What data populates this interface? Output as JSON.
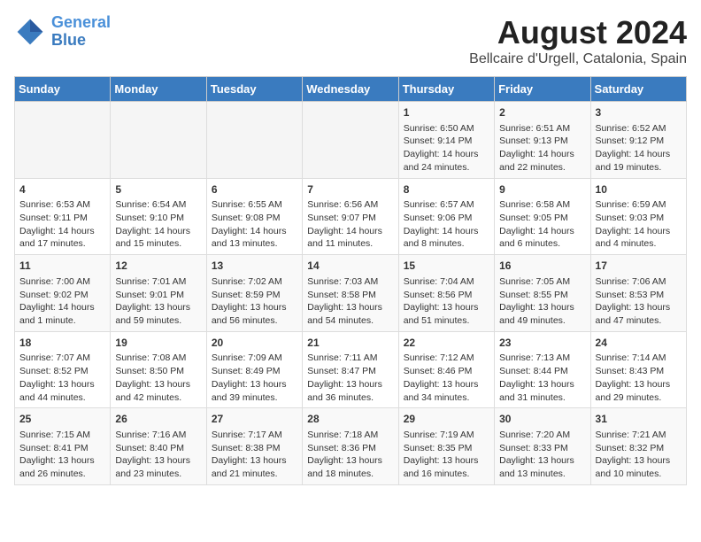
{
  "header": {
    "logo_line1": "General",
    "logo_line2": "Blue",
    "title": "August 2024",
    "subtitle": "Bellcaire d'Urgell, Catalonia, Spain"
  },
  "days_of_week": [
    "Sunday",
    "Monday",
    "Tuesday",
    "Wednesday",
    "Thursday",
    "Friday",
    "Saturday"
  ],
  "weeks": [
    [
      {
        "day": "",
        "text": ""
      },
      {
        "day": "",
        "text": ""
      },
      {
        "day": "",
        "text": ""
      },
      {
        "day": "",
        "text": ""
      },
      {
        "day": "1",
        "text": "Sunrise: 6:50 AM\nSunset: 9:14 PM\nDaylight: 14 hours and 24 minutes."
      },
      {
        "day": "2",
        "text": "Sunrise: 6:51 AM\nSunset: 9:13 PM\nDaylight: 14 hours and 22 minutes."
      },
      {
        "day": "3",
        "text": "Sunrise: 6:52 AM\nSunset: 9:12 PM\nDaylight: 14 hours and 19 minutes."
      }
    ],
    [
      {
        "day": "4",
        "text": "Sunrise: 6:53 AM\nSunset: 9:11 PM\nDaylight: 14 hours and 17 minutes."
      },
      {
        "day": "5",
        "text": "Sunrise: 6:54 AM\nSunset: 9:10 PM\nDaylight: 14 hours and 15 minutes."
      },
      {
        "day": "6",
        "text": "Sunrise: 6:55 AM\nSunset: 9:08 PM\nDaylight: 14 hours and 13 minutes."
      },
      {
        "day": "7",
        "text": "Sunrise: 6:56 AM\nSunset: 9:07 PM\nDaylight: 14 hours and 11 minutes."
      },
      {
        "day": "8",
        "text": "Sunrise: 6:57 AM\nSunset: 9:06 PM\nDaylight: 14 hours and 8 minutes."
      },
      {
        "day": "9",
        "text": "Sunrise: 6:58 AM\nSunset: 9:05 PM\nDaylight: 14 hours and 6 minutes."
      },
      {
        "day": "10",
        "text": "Sunrise: 6:59 AM\nSunset: 9:03 PM\nDaylight: 14 hours and 4 minutes."
      }
    ],
    [
      {
        "day": "11",
        "text": "Sunrise: 7:00 AM\nSunset: 9:02 PM\nDaylight: 14 hours and 1 minute."
      },
      {
        "day": "12",
        "text": "Sunrise: 7:01 AM\nSunset: 9:01 PM\nDaylight: 13 hours and 59 minutes."
      },
      {
        "day": "13",
        "text": "Sunrise: 7:02 AM\nSunset: 8:59 PM\nDaylight: 13 hours and 56 minutes."
      },
      {
        "day": "14",
        "text": "Sunrise: 7:03 AM\nSunset: 8:58 PM\nDaylight: 13 hours and 54 minutes."
      },
      {
        "day": "15",
        "text": "Sunrise: 7:04 AM\nSunset: 8:56 PM\nDaylight: 13 hours and 51 minutes."
      },
      {
        "day": "16",
        "text": "Sunrise: 7:05 AM\nSunset: 8:55 PM\nDaylight: 13 hours and 49 minutes."
      },
      {
        "day": "17",
        "text": "Sunrise: 7:06 AM\nSunset: 8:53 PM\nDaylight: 13 hours and 47 minutes."
      }
    ],
    [
      {
        "day": "18",
        "text": "Sunrise: 7:07 AM\nSunset: 8:52 PM\nDaylight: 13 hours and 44 minutes."
      },
      {
        "day": "19",
        "text": "Sunrise: 7:08 AM\nSunset: 8:50 PM\nDaylight: 13 hours and 42 minutes."
      },
      {
        "day": "20",
        "text": "Sunrise: 7:09 AM\nSunset: 8:49 PM\nDaylight: 13 hours and 39 minutes."
      },
      {
        "day": "21",
        "text": "Sunrise: 7:11 AM\nSunset: 8:47 PM\nDaylight: 13 hours and 36 minutes."
      },
      {
        "day": "22",
        "text": "Sunrise: 7:12 AM\nSunset: 8:46 PM\nDaylight: 13 hours and 34 minutes."
      },
      {
        "day": "23",
        "text": "Sunrise: 7:13 AM\nSunset: 8:44 PM\nDaylight: 13 hours and 31 minutes."
      },
      {
        "day": "24",
        "text": "Sunrise: 7:14 AM\nSunset: 8:43 PM\nDaylight: 13 hours and 29 minutes."
      }
    ],
    [
      {
        "day": "25",
        "text": "Sunrise: 7:15 AM\nSunset: 8:41 PM\nDaylight: 13 hours and 26 minutes."
      },
      {
        "day": "26",
        "text": "Sunrise: 7:16 AM\nSunset: 8:40 PM\nDaylight: 13 hours and 23 minutes."
      },
      {
        "day": "27",
        "text": "Sunrise: 7:17 AM\nSunset: 8:38 PM\nDaylight: 13 hours and 21 minutes."
      },
      {
        "day": "28",
        "text": "Sunrise: 7:18 AM\nSunset: 8:36 PM\nDaylight: 13 hours and 18 minutes."
      },
      {
        "day": "29",
        "text": "Sunrise: 7:19 AM\nSunset: 8:35 PM\nDaylight: 13 hours and 16 minutes."
      },
      {
        "day": "30",
        "text": "Sunrise: 7:20 AM\nSunset: 8:33 PM\nDaylight: 13 hours and 13 minutes."
      },
      {
        "day": "31",
        "text": "Sunrise: 7:21 AM\nSunset: 8:32 PM\nDaylight: 13 hours and 10 minutes."
      }
    ]
  ]
}
